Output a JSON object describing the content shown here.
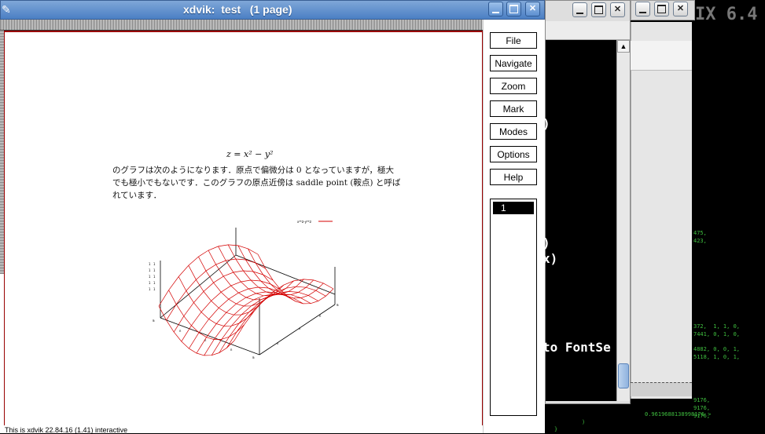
{
  "desktop": {
    "logo_text": "IX 6.4"
  },
  "xdvik": {
    "title": "xdvik:  test   (1 page)",
    "menu": [
      "File",
      "Navigate",
      "Zoom",
      "Mark",
      "Modes",
      "Options",
      "Help"
    ],
    "page_list": [
      "1"
    ],
    "status_text": "This is xdvik 22.84.16 (1.41) interactive",
    "document": {
      "equation": "z = x² − y²",
      "paragraph": [
        "のグラフは次のようになります．原点で偏微分は 0 となっていますが，極大",
        "でも極小でもないです．このグラフの原点近傍は saddle point (鞍点) と呼ば",
        "れています．"
      ],
      "legend_label": "x**2-y**2"
    }
  },
  "terminal": {
    "lines": [
      ")",
      ")",
      "x)",
      "to FontSe"
    ]
  },
  "bg_terminal": {
    "lines": [
      "475,",
      "423,",
      "372,  1, 1, 0,",
      "7441, 0, 1, 0,",
      "4882, 0, 0, 1,",
      "5118, 1, 0, 1,",
      "9176,",
      "9176,",
      "9176,",
      "0.9619688138998176 >",
      ")",
      "}"
    ]
  },
  "colors": {
    "plot_line": "#d40000",
    "titlebar": "#5b8bcb"
  }
}
